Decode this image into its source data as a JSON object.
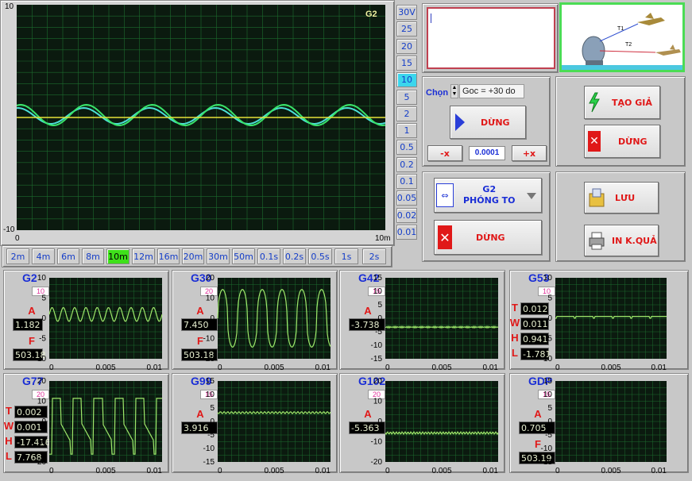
{
  "main_scope": {
    "y_max": "10",
    "y_min": "-10",
    "x_min": "0",
    "x_max": "10m",
    "channel": "G2",
    "scale_buttons": [
      "30V",
      "25",
      "20",
      "15",
      "10",
      "5",
      "2",
      "1",
      "0.5",
      "0.2",
      "0.1",
      "0.05",
      "0.02",
      "0.01"
    ],
    "active_scale": "10",
    "time_buttons": [
      "2m",
      "4m",
      "6m",
      "8m",
      "10m",
      "12m",
      "16m",
      "20m",
      "30m",
      "50m",
      "0.1s",
      "0.2s",
      "0.5s",
      "1s",
      "2s"
    ],
    "active_time": "10m"
  },
  "controls": {
    "chon_label": "Chọn",
    "angle_value": "Goc = +30 do",
    "stop_button": "DỪNG",
    "minus_x": "-x",
    "step_value": "0.0001",
    "plus_x": "+x",
    "zoom_channel": "G2",
    "zoom_label": "PHÓNG TO",
    "stop_button_2": "DỪNG",
    "fake_button": "TẠO GIẢ",
    "stop_button_3": "DỪNG",
    "save_button": "LƯU",
    "print_button": "IN K.QUẢ"
  },
  "illustration": {
    "t1": "T1",
    "t2": "T2"
  },
  "small_scopes": [
    {
      "name": "G2",
      "scale": "10",
      "params": [
        {
          "label": "A",
          "value": "1.182"
        },
        {
          "label": "F",
          "value": "503.18"
        }
      ],
      "y_ticks": [
        "10",
        "5",
        "0",
        "-5",
        "-10"
      ],
      "x_ticks": [
        "0",
        "0.005",
        "0.01"
      ]
    },
    {
      "name": "G30",
      "scale": "20",
      "params": [
        {
          "label": "A",
          "value": "7.450"
        },
        {
          "label": "F",
          "value": "503.18"
        }
      ],
      "y_ticks": [
        "20",
        "10",
        "0",
        "-10",
        "-20"
      ],
      "x_ticks": [
        "0",
        "0.005",
        "0.01"
      ]
    },
    {
      "name": "G42",
      "scale": "15",
      "params": [
        {
          "label": "A",
          "value": "-3.738"
        }
      ],
      "y_ticks": [
        "15",
        "10",
        "5",
        "0",
        "-5",
        "-10",
        "-15"
      ],
      "x_ticks": [
        "0",
        "0.005",
        "0.01"
      ]
    },
    {
      "name": "G53",
      "scale": "10",
      "params": [
        {
          "label": "T",
          "value": "0.012"
        },
        {
          "label": "W",
          "value": "0.011"
        },
        {
          "label": "H",
          "value": "0.941"
        },
        {
          "label": "L",
          "value": "-1.781"
        }
      ],
      "y_ticks": [
        "10",
        "5",
        "0",
        "-5",
        "-10"
      ],
      "x_ticks": [
        "0",
        "0.005",
        "0.01"
      ]
    },
    {
      "name": "G77",
      "scale": "20",
      "params": [
        {
          "label": "T",
          "value": "0.002"
        },
        {
          "label": "W",
          "value": "0.001"
        },
        {
          "label": "H",
          "value": "-17.416"
        },
        {
          "label": "L",
          "value": "7.768"
        }
      ],
      "y_ticks": [
        "20",
        "10",
        "0",
        "-10",
        "-20"
      ],
      "x_ticks": [
        "0",
        "0.005",
        "0.01"
      ]
    },
    {
      "name": "G99",
      "scale": "15",
      "params": [
        {
          "label": "A",
          "value": "3.916"
        }
      ],
      "y_ticks": [
        "15",
        "10",
        "5",
        "0",
        "-5",
        "-10",
        "-15"
      ],
      "x_ticks": [
        "0",
        "0.005",
        "0.01"
      ]
    },
    {
      "name": "G102",
      "scale": "20",
      "params": [
        {
          "label": "A",
          "value": "-5.363"
        }
      ],
      "y_ticks": [
        "20",
        "10",
        "0",
        "-10",
        "-20"
      ],
      "x_ticks": [
        "0",
        "0.005",
        "0.01"
      ]
    },
    {
      "name": "GDP",
      "scale": "15",
      "params": [
        {
          "label": "A",
          "value": "0.705"
        },
        {
          "label": "F",
          "value": "503.19"
        }
      ],
      "y_ticks": [
        "15",
        "10",
        "5",
        "0",
        "-5",
        "-10",
        "-15"
      ],
      "x_ticks": [
        "0",
        "0.005",
        "0.01"
      ]
    }
  ],
  "colors": {
    "trace_green": "#39e36a",
    "trace_cyan": "#4ce0d8",
    "trace_yellow": "#e8e23a",
    "grid": "#1d6b2e",
    "screen": "#0b1a0f",
    "accent": "#1a2ed6",
    "label_red": "#e01818",
    "active_cyan": "#3bd6ec",
    "active_green": "#3ee01a"
  }
}
